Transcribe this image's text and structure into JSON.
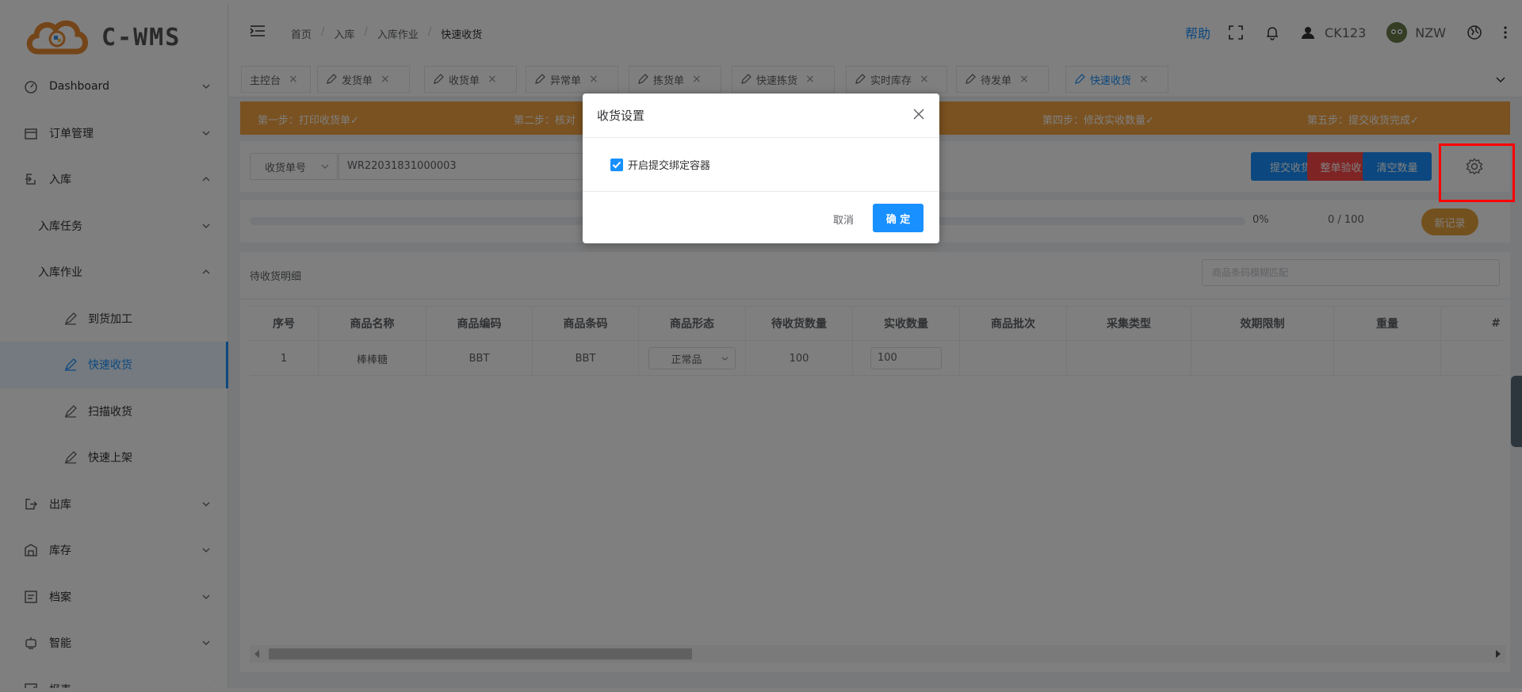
{
  "app": {
    "logo_text": "C-WMS"
  },
  "sidebar": {
    "items": [
      {
        "label": "Dashboard",
        "icon": "dashboard-icon",
        "expanded": false
      },
      {
        "label": "订单管理",
        "icon": "order-icon",
        "expanded": false
      },
      {
        "label": "入库",
        "icon": "inbound-icon",
        "expanded": true
      },
      {
        "label": "入库任务",
        "expanded": false
      },
      {
        "label": "入库作业",
        "expanded": true
      },
      {
        "label": "到货加工",
        "icon": "edit-icon"
      },
      {
        "label": "快速收货",
        "icon": "edit-icon",
        "active": true
      },
      {
        "label": "扫描收货",
        "icon": "edit-icon"
      },
      {
        "label": "快速上架",
        "icon": "edit-icon"
      },
      {
        "label": "出库",
        "icon": "outbound-icon",
        "expanded": false
      },
      {
        "label": "库存",
        "icon": "inventory-icon",
        "expanded": false
      },
      {
        "label": "档案",
        "icon": "archive-icon",
        "expanded": false
      },
      {
        "label": "智能",
        "icon": "smart-icon",
        "expanded": false
      },
      {
        "label": "报表",
        "icon": "report-icon",
        "expanded": false
      }
    ]
  },
  "header": {
    "breadcrumb": [
      "首页",
      "入库",
      "入库作业",
      "快速收货"
    ],
    "help": "帮助",
    "warehouse": "CK123",
    "username": "NZW"
  },
  "tabs": [
    {
      "label": "主控台"
    },
    {
      "label": "发货单"
    },
    {
      "label": "收货单"
    },
    {
      "label": "异常单"
    },
    {
      "label": "拣货单"
    },
    {
      "label": "快速拣货"
    },
    {
      "label": "实时库存"
    },
    {
      "label": "待发单"
    },
    {
      "label": "快速收货",
      "active": true
    }
  ],
  "steps": [
    "第一步：打印收货单✓",
    "第二步：核对",
    "第四步：修改实收数量✓",
    "第五步：提交收货完成✓"
  ],
  "toolbar": {
    "select_value": "收货单号",
    "order_number": "WR22031831000003",
    "submit_label": "提交收货",
    "verify_label": "整单验收",
    "clear_label": "清空数量"
  },
  "progress": {
    "percent_text": "0%",
    "count_text": "0 / 100",
    "value": 0,
    "new_record_label": "新记录"
  },
  "detail": {
    "title": "待收货明细",
    "filter_placeholder": "商品条码模糊匹配"
  },
  "table": {
    "columns": [
      "序号",
      "商品名称",
      "商品编码",
      "商品条码",
      "商品形态",
      "待收货数量",
      "实收数量",
      "商品批次",
      "采集类型",
      "效期限制",
      "重量",
      "#"
    ],
    "rows": [
      {
        "index": "1",
        "name": "棒棒糖",
        "code": "BBT",
        "barcode": "BBT",
        "form": "正常品",
        "pending_qty": "100",
        "received_qty": "100"
      }
    ]
  },
  "modal": {
    "title": "收货设置",
    "checkbox_label": "开启提交绑定容器",
    "checked": true,
    "cancel_label": "取消",
    "ok_label": "确 定"
  },
  "colors": {
    "primary": "#1890ff",
    "steps_bg": "#f5a442",
    "danger": "#ff4949",
    "warning": "#e6a23c",
    "highlight_box": "#ff0000"
  }
}
